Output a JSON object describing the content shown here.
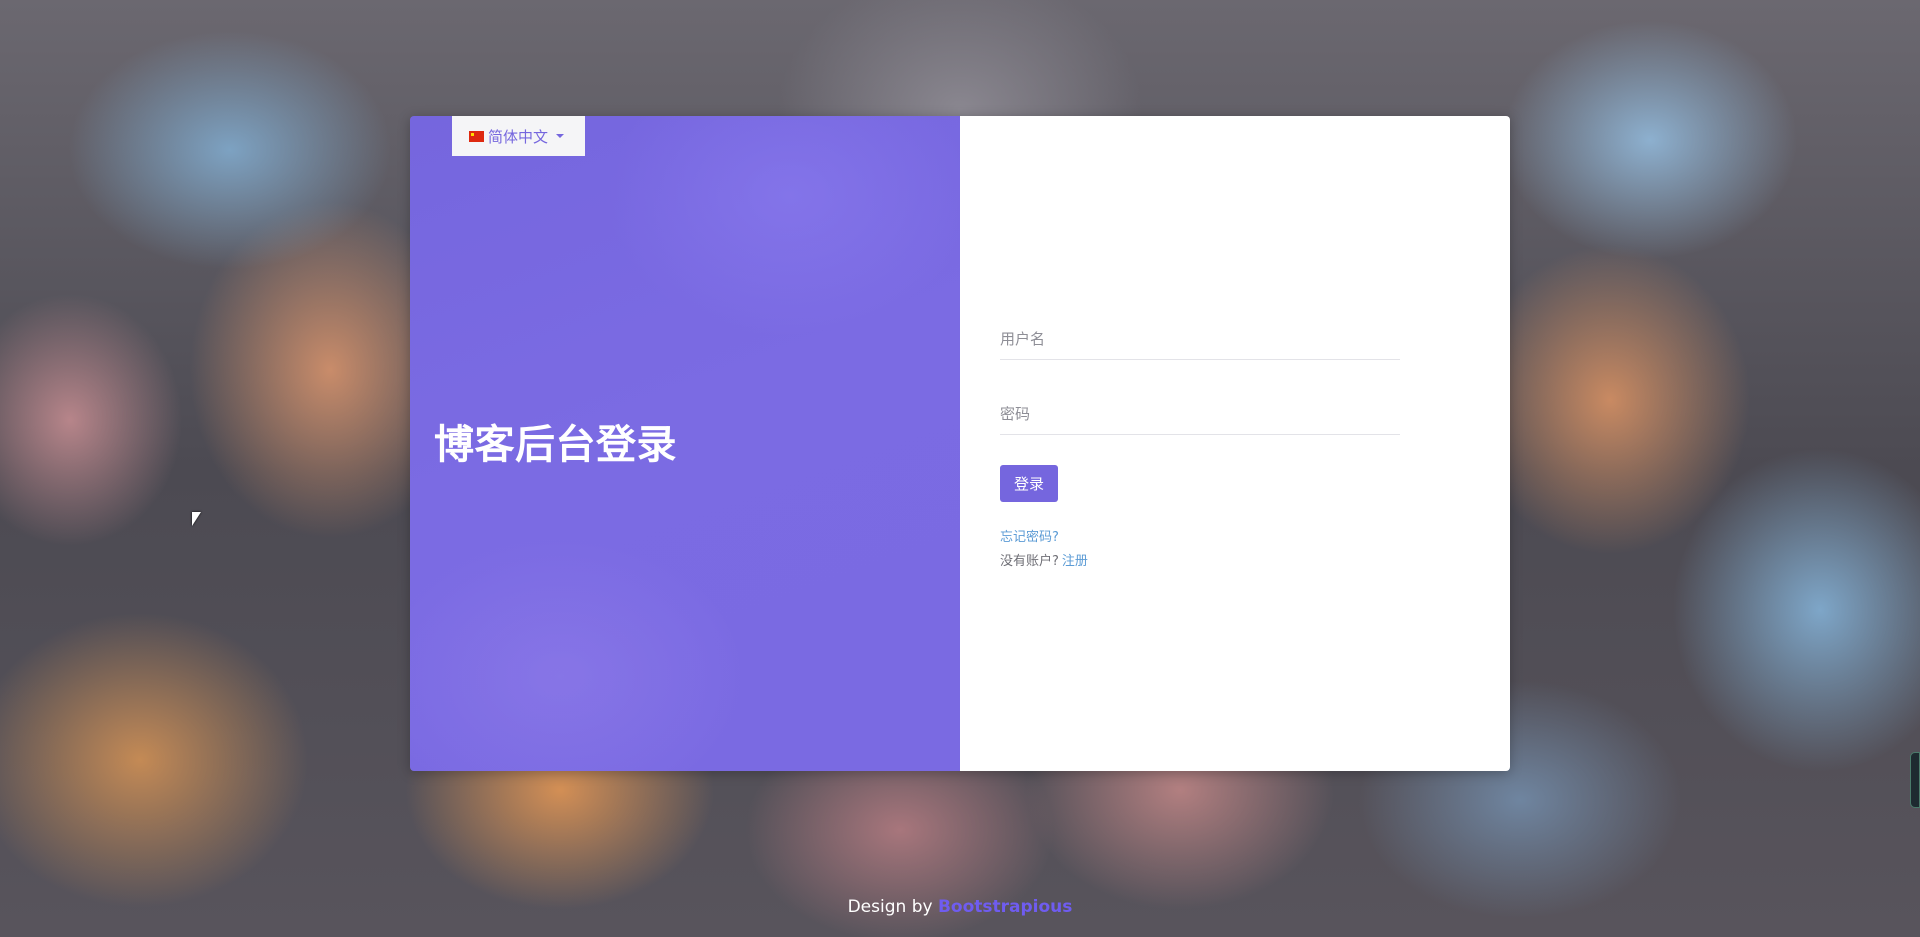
{
  "language": {
    "label": "简体中文",
    "flag": "cn-flag-icon"
  },
  "left": {
    "title": "博客后台登录"
  },
  "form": {
    "username_placeholder": "用户名",
    "password_placeholder": "密码",
    "login_button": "登录",
    "forgot_password": "忘记密码?",
    "no_account": "没有账户?",
    "register": "注册"
  },
  "footer": {
    "prefix": "Design by ",
    "link": "Bootstrapious"
  },
  "colors": {
    "accent": "#7566de",
    "link": "#5b9bd5"
  }
}
